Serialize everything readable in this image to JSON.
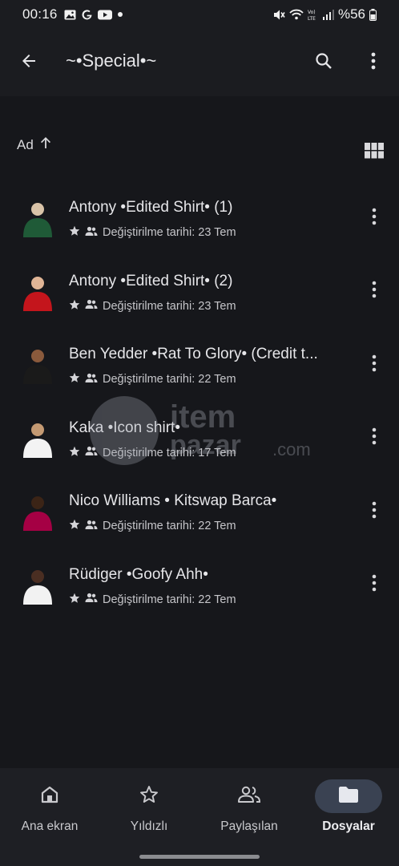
{
  "status_bar": {
    "time": "00:16",
    "battery_percent": "%56",
    "left_icons": [
      "gallery-icon",
      "google-icon",
      "youtube-icon",
      "dot-icon"
    ],
    "right_icons": [
      "mute-icon",
      "wifi-icon",
      "volte-icon",
      "signal-icon",
      "battery-icon"
    ]
  },
  "app_bar": {
    "title": "~•Special•~",
    "icons": [
      "back-arrow-icon",
      "search-icon",
      "more-vert-icon"
    ]
  },
  "sort": {
    "label": "Ad",
    "direction_icon": "arrow-up-icon",
    "view_toggle_icon": "grid-view-icon"
  },
  "files": [
    {
      "name": "Antony •Edited Shirt• (1)",
      "modified": "Değiştirilme tarihi: 23 Tem",
      "starred": true,
      "shared": true,
      "thumb_colors": [
        "#1f5a37",
        "#d9c3a8"
      ]
    },
    {
      "name": "Antony •Edited Shirt• (2)",
      "modified": "Değiştirilme tarihi: 23 Tem",
      "starred": true,
      "shared": true,
      "thumb_colors": [
        "#c4151c",
        "#e0b596"
      ]
    },
    {
      "name": "Ben Yedder •Rat To Glory• (Credit t...",
      "modified": "Değiştirilme tarihi: 22 Tem",
      "starred": true,
      "shared": true,
      "thumb_colors": [
        "#1a1a1a",
        "#8a5a3c"
      ]
    },
    {
      "name": "Kaka •Icon shirt•",
      "modified": "Değiştirilme tarihi: 17 Tem",
      "starred": true,
      "shared": true,
      "thumb_colors": [
        "#f3f3f3",
        "#c49a73"
      ]
    },
    {
      "name": "Nico Williams • Kitswap Barca•",
      "modified": "Değiştirilme tarihi: 22 Tem",
      "starred": true,
      "shared": true,
      "thumb_colors": [
        "#a50044",
        "#3b2416"
      ]
    },
    {
      "name": "Rüdiger •Goofy Ahh•",
      "modified": "Değiştirilme tarihi: 22 Tem",
      "starred": true,
      "shared": true,
      "thumb_colors": [
        "#f2f2f2",
        "#4a2e22"
      ]
    }
  ],
  "watermark": {
    "line1": "item",
    "line2": "pazar",
    "line3": ".com"
  },
  "bottom_nav": {
    "items": [
      {
        "label": "Ana ekran",
        "icon": "home-icon",
        "active": false
      },
      {
        "label": "Yıldızlı",
        "icon": "star-outline-icon",
        "active": false
      },
      {
        "label": "Paylaşılan",
        "icon": "people-icon",
        "active": false
      },
      {
        "label": "Dosyalar",
        "icon": "folder-icon",
        "active": true
      }
    ]
  },
  "colors": {
    "background": "#16171b",
    "app_bar": "#1b1c20",
    "nav_bar": "#1e1f24",
    "active_pill": "#3a4252",
    "text_primary": "#e6e6e9",
    "text_secondary": "#c6c6ca"
  }
}
